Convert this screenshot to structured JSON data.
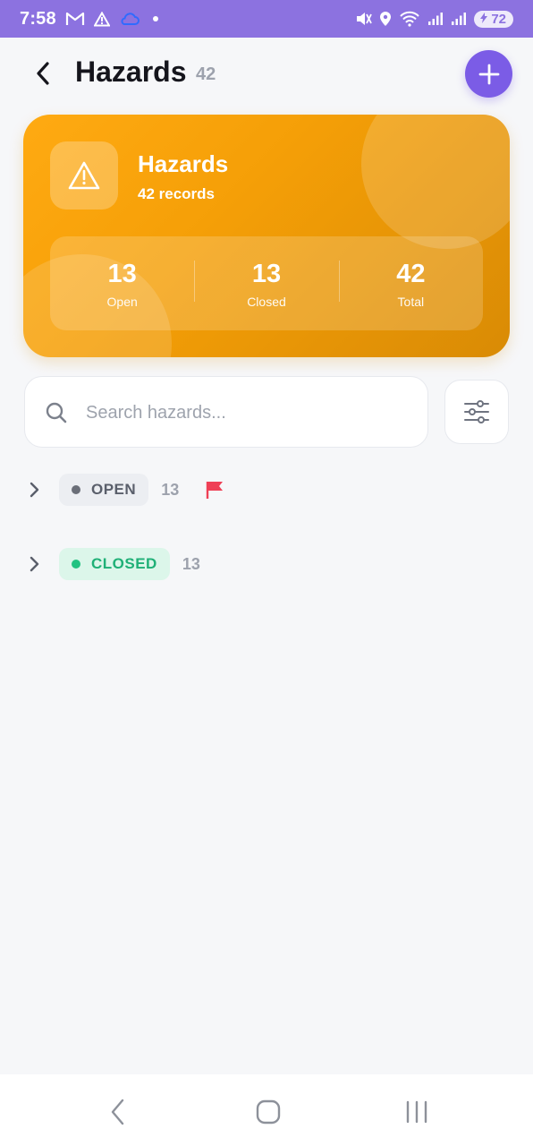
{
  "status_bar": {
    "time": "7:58",
    "battery": "72",
    "accent": "#8c72e0",
    "icons": [
      "gmail-icon",
      "warning-icon",
      "cloud-icon",
      "dot-icon",
      "mute-icon",
      "location-icon",
      "wifi-icon",
      "signal-icon",
      "signal-icon",
      "battery-icon"
    ]
  },
  "header": {
    "title": "Hazards",
    "count": "42",
    "add_button_color": "#7b5ce6"
  },
  "summary_card": {
    "title": "Hazards",
    "subtitle": "42 records",
    "icon": "warning-triangle-icon",
    "gradient": [
      "#ffaa12",
      "#d98b05"
    ],
    "stats": [
      {
        "value": "13",
        "label": "Open"
      },
      {
        "value": "13",
        "label": "Closed"
      },
      {
        "value": "42",
        "label": "Total"
      }
    ]
  },
  "search": {
    "placeholder": "Search hazards...",
    "value": ""
  },
  "groups": [
    {
      "label": "OPEN",
      "count": "13",
      "dot_color": "#6a6e78",
      "flagged": true,
      "flag_color": "#ef4056"
    },
    {
      "label": "CLOSED",
      "count": "13",
      "dot_color": "#22c281",
      "flagged": false
    }
  ],
  "nav_bar": {
    "buttons": [
      "back-nav-icon",
      "home-nav-icon",
      "recents-nav-icon"
    ]
  }
}
